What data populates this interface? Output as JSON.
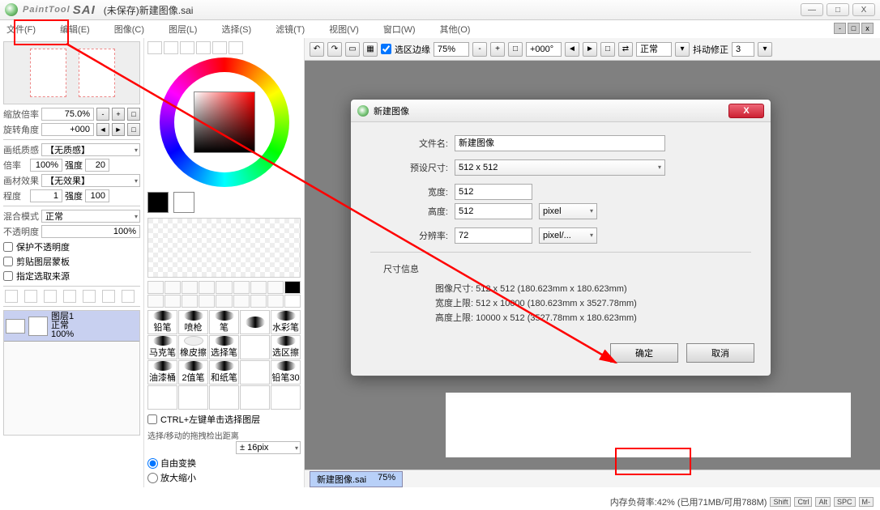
{
  "title": {
    "app_prefix": "PaintTool",
    "app": "SAI",
    "file": "(未保存)新建图像.sai"
  },
  "win_buttons": {
    "min": "—",
    "max": "□",
    "close": "X"
  },
  "menu": [
    "文件(F)",
    "编辑(E)",
    "图像(C)",
    "图层(L)",
    "选择(S)",
    "滤镜(T)",
    "视图(V)",
    "窗口(W)",
    "其他(O)"
  ],
  "left": {
    "zoom_label": "缩放倍率",
    "zoom_value": "75.0%",
    "rotate_label": "旋转角度",
    "rotate_value": "+000",
    "paper_feel": "画纸质感",
    "paper_none": "【无质感】",
    "mag_label": "倍率",
    "mag_value": "100%",
    "strength_label": "强度",
    "strength_value": "20",
    "material": "画材效果",
    "material_none": "【无效果】",
    "degree_label": "程度",
    "degree_value": "1",
    "strength2_value": "100",
    "blend_label": "混合模式",
    "blend_value": "正常",
    "opacity_label": "不透明度",
    "opacity_value": "100%",
    "chk1": "保护不透明度",
    "chk2": "剪贴图层蒙板",
    "chk3": "指定选取来源",
    "layer": {
      "name": "图层1",
      "mode": "正常",
      "opacity": "100%"
    }
  },
  "brushes": [
    "铅笔",
    "喷枪",
    "笔",
    "",
    "水彩笔",
    "马克笔",
    "橡皮擦",
    "选择笔",
    "",
    "选区擦",
    "油漆桶",
    "2值笔",
    "和纸笔",
    "",
    "铅笔30"
  ],
  "ctrl_hint": "CTRL+左键单击选择图层",
  "move_hint": "选择/移动的拖拽检出距离",
  "move_px": "± 16pix",
  "radio1": "自由变换",
  "radio2": "放大缩小",
  "canvas_toolbar": {
    "sel_edge": "选区边缘",
    "zoom": "75%",
    "angle": "+000°",
    "mode": "正常",
    "stabilizer_label": "抖动修正",
    "stabilizer_value": "3"
  },
  "tab": {
    "name": "新建图像.sai",
    "pct": "75%"
  },
  "status": {
    "mem": "内存负荷率:42% (已用71MB/可用788M)",
    "keys": [
      "Shift",
      "Ctrl",
      "Alt",
      "SPC",
      "M-"
    ]
  },
  "dialog": {
    "title": "新建图像",
    "filename_label": "文件名:",
    "filename": "新建图像",
    "preset_label": "预设尺寸:",
    "preset": "512 x  512",
    "width_label": "宽度:",
    "width": "512",
    "height_label": "高度:",
    "height": "512",
    "unit_wh": "pixel",
    "res_label": "分辨率:",
    "res": "72",
    "res_unit": "pixel/...",
    "size_header": "尺寸信息",
    "size_line1": "图像尺寸: 512 x 512 (180.623mm x 180.623mm)",
    "size_line2": "宽度上限: 512 x 10000 (180.623mm x 3527.78mm)",
    "size_line3": "高度上限: 10000 x 512 (3527.78mm x 180.623mm)",
    "ok": "确定",
    "cancel": "取消"
  }
}
